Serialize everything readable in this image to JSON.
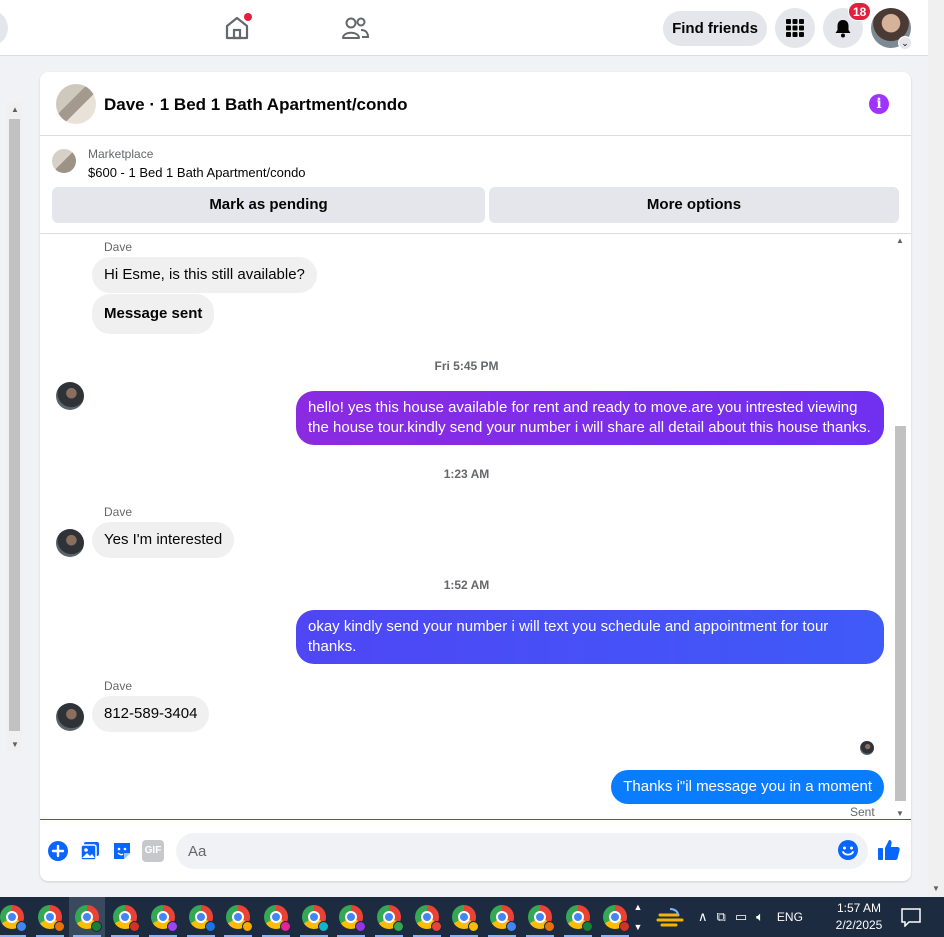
{
  "nav": {
    "notifications_count": "18",
    "find_friends_label": "Find friends"
  },
  "chat": {
    "title": "Dave · 1 Bed 1 Bath Apartment/condo",
    "marketplace_label": "Marketplace",
    "listing": "$600 - 1 Bed 1 Bath Apartment/condo",
    "mark_pending_label": "Mark as pending",
    "more_options_label": "More options"
  },
  "messages": {
    "sender_1": "Dave",
    "in_1": "Hi Esme, is this still available?",
    "in_2": "Message sent",
    "stamp_1": "Fri 5:45 PM",
    "out_1": "hello! yes this house available for rent and ready to move.are you intrested viewing the house tour.kindly send your number i will share all detail about this house thanks.",
    "stamp_2": "1:23 AM",
    "sender_2": "Dave",
    "in_3": "Yes I'm interested",
    "stamp_3": "1:52 AM",
    "out_2": "okay kindly send your number i will text you schedule and appointment for tour thanks.",
    "sender_3": "Dave",
    "in_4": "812-589-3404",
    "out_3": "Thanks i\"il message you in a moment",
    "status": "Sent"
  },
  "composer": {
    "placeholder": "Aa",
    "gif_label": "GIF"
  },
  "taskbar": {
    "language": "ENG",
    "time": "1:57 AM",
    "date": "2/2/2025",
    "app_count": 17
  },
  "colors": {
    "accent": "#0866ff",
    "outgoing_gradient_1": "#7b2ff0",
    "outgoing_gradient_2": "#4751f6",
    "outgoing_solid": "#0a7cff",
    "badge": "#e41e3f",
    "info": "#a033ff"
  },
  "icons": [
    "home-icon",
    "friends-icon",
    "menu-grid-icon",
    "bell-icon",
    "info-icon",
    "plus-icon",
    "photo-icon",
    "sticker-icon",
    "gif-icon",
    "emoji-icon",
    "like-icon",
    "chrome-icon"
  ]
}
